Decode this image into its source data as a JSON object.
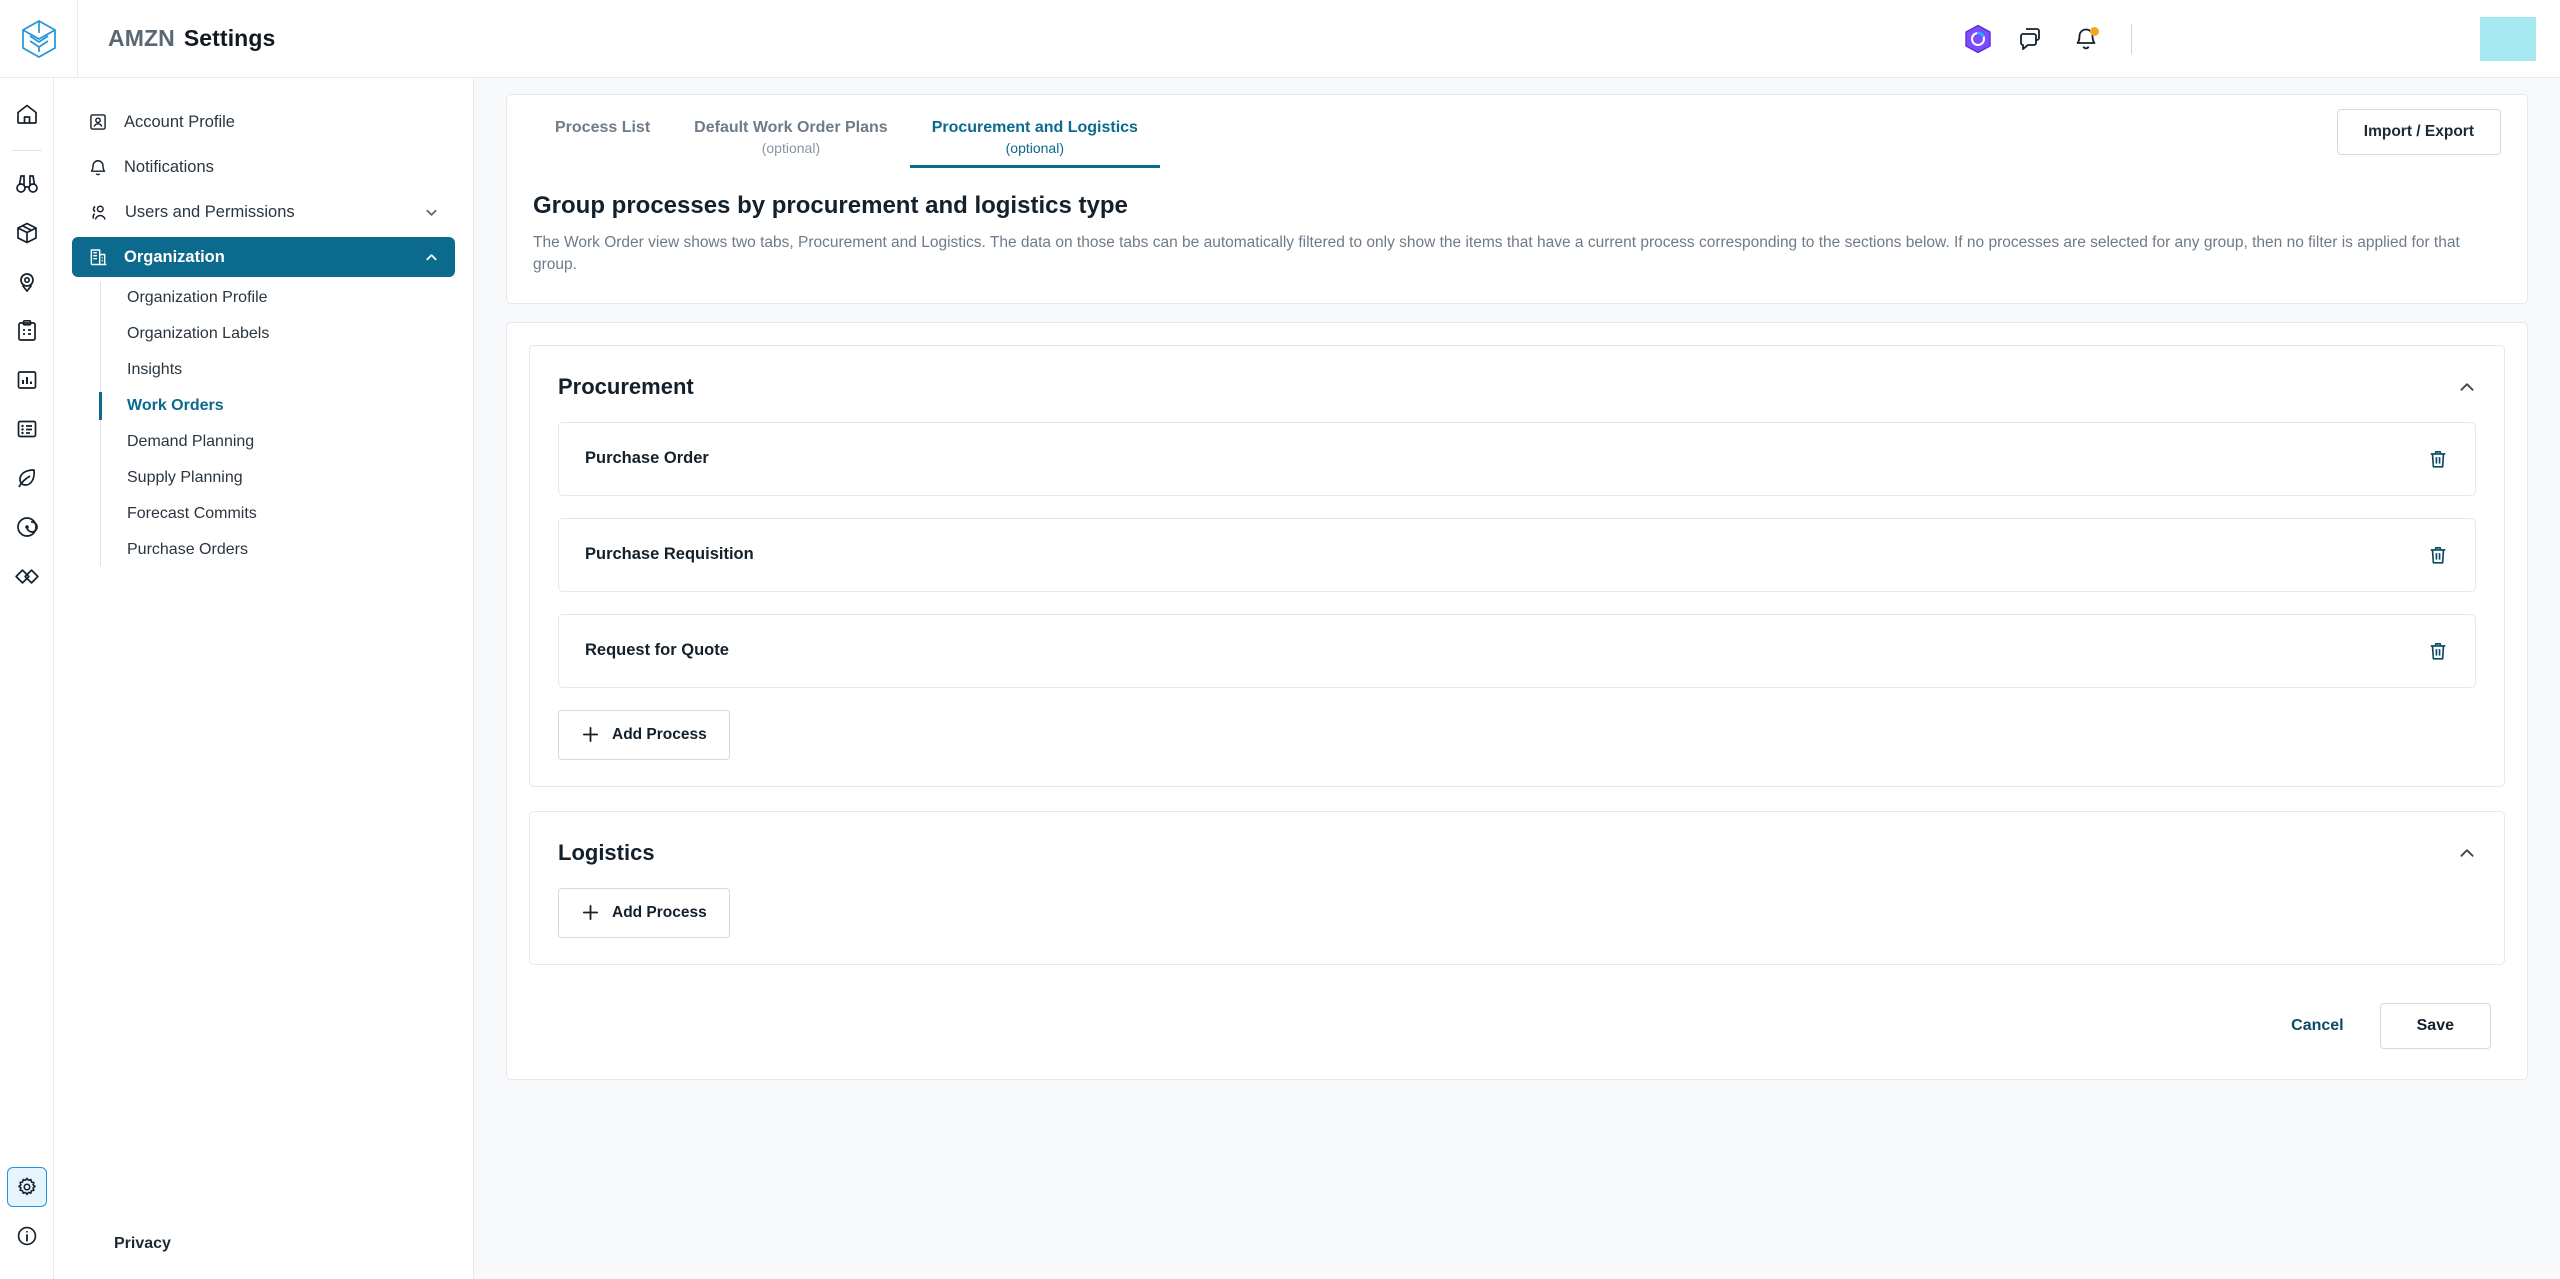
{
  "topbar": {
    "brand_logo_icon": "cube-logo-icon",
    "account_name": "AMZN",
    "app_name": "Settings",
    "icons": [
      {
        "name": "ai-assistant-icon"
      },
      {
        "name": "chat-bubbles-icon"
      },
      {
        "name": "notifications-bell-icon"
      }
    ],
    "avatar_color": "#a5e8f0"
  },
  "rail": {
    "items": [
      {
        "name": "home-icon"
      },
      {
        "name": "binoculars-icon"
      },
      {
        "name": "package-box-icon"
      },
      {
        "name": "location-pin-icon"
      },
      {
        "name": "clipboard-icon"
      },
      {
        "name": "bar-chart-icon"
      },
      {
        "name": "list-report-icon"
      },
      {
        "name": "leaf-icon"
      },
      {
        "name": "radar-icon"
      },
      {
        "name": "diamonds-icon"
      }
    ],
    "bottom": [
      {
        "name": "settings-gear-icon",
        "active": true
      },
      {
        "name": "info-circle-icon",
        "active": false
      }
    ]
  },
  "sidebar": {
    "items": [
      {
        "label": "Account Profile",
        "icon": "account-profile-icon",
        "active": false,
        "expandable": false
      },
      {
        "label": "Notifications",
        "icon": "bell-icon",
        "active": false,
        "expandable": false
      },
      {
        "label": "Users and Permissions",
        "icon": "users-icon",
        "active": false,
        "expandable": true
      },
      {
        "label": "Organization",
        "icon": "organization-building-icon",
        "active": true,
        "expandable": true
      }
    ],
    "organization_children": [
      {
        "label": "Organization Profile",
        "selected": false
      },
      {
        "label": "Organization Labels",
        "selected": false
      },
      {
        "label": "Insights",
        "selected": false
      },
      {
        "label": "Work Orders",
        "selected": true
      },
      {
        "label": "Demand Planning",
        "selected": false
      },
      {
        "label": "Supply Planning",
        "selected": false
      },
      {
        "label": "Forecast Commits",
        "selected": false
      },
      {
        "label": "Purchase Orders",
        "selected": false
      }
    ],
    "privacy_link": "Privacy"
  },
  "main": {
    "tabs": [
      {
        "label": "Process List",
        "sub": "",
        "active": false
      },
      {
        "label": "Default Work Order Plans",
        "sub": "(optional)",
        "active": false
      },
      {
        "label": "Procurement and Logistics",
        "sub": "(optional)",
        "active": true
      }
    ],
    "import_export_label": "Import / Export",
    "heading": "Group processes by procurement and logistics type",
    "description": "The Work Order view shows two tabs, Procurement and Logistics. The data on those tabs can be automatically filtered to only show the items that have a current process corresponding to the sections below. If no processes are selected for any group, then no filter is applied for that group.",
    "groups": [
      {
        "name": "Procurement",
        "collapse_icon": "chevron-up-icon",
        "processes": [
          {
            "name": "Purchase Order",
            "delete_icon": "trash-icon"
          },
          {
            "name": "Purchase Requisition",
            "delete_icon": "trash-icon"
          },
          {
            "name": "Request for Quote",
            "delete_icon": "trash-icon"
          }
        ],
        "add_label": "Add Process"
      },
      {
        "name": "Logistics",
        "collapse_icon": "chevron-up-icon",
        "processes": [],
        "add_label": "Add Process"
      }
    ],
    "cancel_label": "Cancel",
    "save_label": "Save"
  },
  "colors": {
    "accent": "#0b6a8e",
    "page_bg": "#f7f9fb",
    "border": "#e4e8ec",
    "badge": "#f5a623"
  }
}
